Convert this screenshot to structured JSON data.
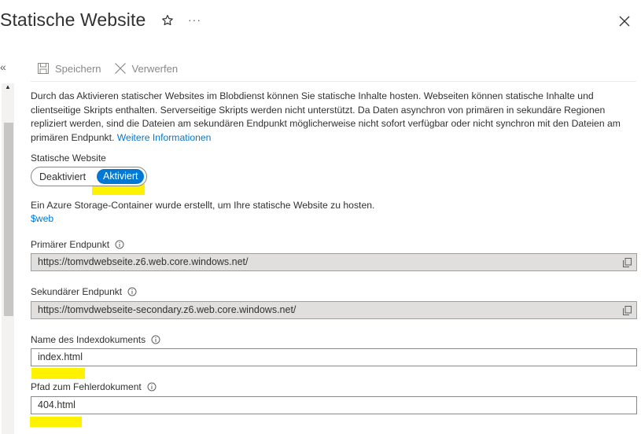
{
  "header": {
    "title": "Statische Website",
    "star_icon": "star-outline-icon",
    "more_icon": "ellipsis-icon",
    "more_label": "···",
    "close_icon": "close-icon",
    "collapse_label": "«"
  },
  "toolbar": {
    "save_label": "Speichern",
    "discard_label": "Verwerfen"
  },
  "description": {
    "text": "Durch das Aktivieren statischer Websites im Blobdienst können Sie statische Inhalte hosten. Webseiten können statische Inhalte und clientseitige Skripts enthalten. Serverseitige Skripts werden nicht unterstützt. Da Daten asynchron von primären in sekundäre Regionen repliziert werden, sind die Dateien am sekundären Endpunkt möglicherweise nicht sofort verfügbar oder nicht synchron mit den Dateien am primären Endpunkt.",
    "link_label": "Weitere Informationen"
  },
  "static_website": {
    "label": "Statische Website",
    "option_off": "Deaktiviert",
    "option_on": "Aktiviert",
    "selected": "Aktiviert"
  },
  "container_info": {
    "text": "Ein Azure Storage-Container wurde erstellt, um Ihre statische Website zu hosten.",
    "container_link": "$web"
  },
  "primary_endpoint": {
    "label": "Primärer Endpunkt",
    "value": "https://tomvdwebseite.z6.web.core.windows.net/"
  },
  "secondary_endpoint": {
    "label": "Sekundärer Endpunkt",
    "value": "https://tomvdwebseite-secondary.z6.web.core.windows.net/"
  },
  "index_document": {
    "label": "Name des Indexdokuments",
    "value": "index.html"
  },
  "error_document": {
    "label": "Pfad zum Fehlerdokument",
    "value": "404.html"
  },
  "colors": {
    "accent": "#0078d4",
    "highlight": "#fff200",
    "readonly_bg": "#e1dfdd"
  }
}
